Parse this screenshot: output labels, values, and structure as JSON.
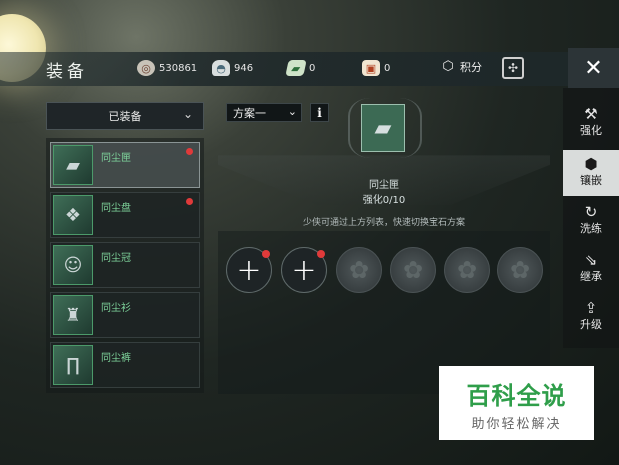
{
  "header": {
    "title": "装备",
    "resources": [
      {
        "icon": "coin-icon",
        "value": "530861"
      },
      {
        "icon": "ingot-icon",
        "value": "946"
      },
      {
        "icon": "ticket-icon",
        "value": "0"
      },
      {
        "icon": "gift-box-icon",
        "value": "0"
      }
    ],
    "score_label": "积分"
  },
  "left_panel": {
    "filter_label": "已装备",
    "items": [
      {
        "name": "同尘匣",
        "icon": "case-icon",
        "badge": true,
        "selected": true
      },
      {
        "name": "同尘盘",
        "icon": "plate-icon",
        "badge": true,
        "selected": false
      },
      {
        "name": "同尘冠",
        "icon": "crown-icon",
        "badge": false,
        "selected": false
      },
      {
        "name": "同尘衫",
        "icon": "shirt-icon",
        "badge": false,
        "selected": false
      },
      {
        "name": "同尘裤",
        "icon": "pants-icon",
        "badge": false,
        "selected": false
      }
    ]
  },
  "center": {
    "scheme_label": "方案一",
    "info_label": "i",
    "equip_name": "同尘匣",
    "equip_level": "强化0/10",
    "hint": "少侠可通过上方列表，快速切换宝石方案"
  },
  "gem_slots": [
    {
      "state": "add",
      "badge": true,
      "symbol": "+"
    },
    {
      "state": "add",
      "badge": true,
      "symbol": "+"
    },
    {
      "state": "locked"
    },
    {
      "state": "locked"
    },
    {
      "state": "locked"
    },
    {
      "state": "locked"
    }
  ],
  "side_tabs": [
    {
      "label": "强化",
      "icon": "hammer-icon",
      "selected": false
    },
    {
      "label": "镶嵌",
      "icon": "gem-icon",
      "selected": true
    },
    {
      "label": "洗练",
      "icon": "refresh-icon",
      "selected": false
    },
    {
      "label": "继承",
      "icon": "inherit-icon",
      "selected": false
    },
    {
      "label": "升级",
      "icon": "upgrade-icon",
      "selected": false
    }
  ],
  "watermark": {
    "main": "百科全说",
    "sub": "助你轻松解决"
  },
  "colors": {
    "item_name": "#7fd59c",
    "badge_red": "#e03a3a",
    "watermark_green": "#2f9e4a"
  }
}
